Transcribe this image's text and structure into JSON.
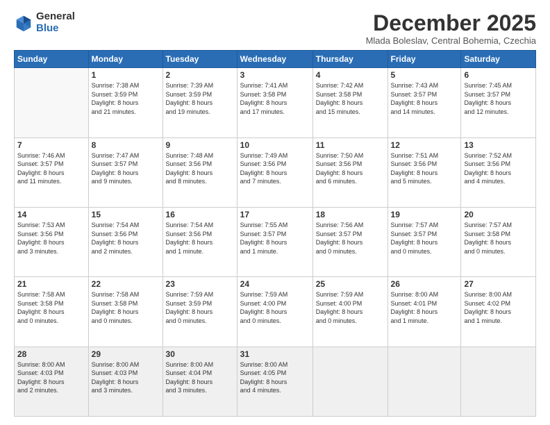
{
  "logo": {
    "general": "General",
    "blue": "Blue"
  },
  "title": "December 2025",
  "subtitle": "Mlada Boleslav, Central Bohemia, Czechia",
  "days_of_week": [
    "Sunday",
    "Monday",
    "Tuesday",
    "Wednesday",
    "Thursday",
    "Friday",
    "Saturday"
  ],
  "weeks": [
    [
      {
        "day": "",
        "info": ""
      },
      {
        "day": "1",
        "info": "Sunrise: 7:38 AM\nSunset: 3:59 PM\nDaylight: 8 hours\nand 21 minutes."
      },
      {
        "day": "2",
        "info": "Sunrise: 7:39 AM\nSunset: 3:59 PM\nDaylight: 8 hours\nand 19 minutes."
      },
      {
        "day": "3",
        "info": "Sunrise: 7:41 AM\nSunset: 3:58 PM\nDaylight: 8 hours\nand 17 minutes."
      },
      {
        "day": "4",
        "info": "Sunrise: 7:42 AM\nSunset: 3:58 PM\nDaylight: 8 hours\nand 15 minutes."
      },
      {
        "day": "5",
        "info": "Sunrise: 7:43 AM\nSunset: 3:57 PM\nDaylight: 8 hours\nand 14 minutes."
      },
      {
        "day": "6",
        "info": "Sunrise: 7:45 AM\nSunset: 3:57 PM\nDaylight: 8 hours\nand 12 minutes."
      }
    ],
    [
      {
        "day": "7",
        "info": "Sunrise: 7:46 AM\nSunset: 3:57 PM\nDaylight: 8 hours\nand 11 minutes."
      },
      {
        "day": "8",
        "info": "Sunrise: 7:47 AM\nSunset: 3:57 PM\nDaylight: 8 hours\nand 9 minutes."
      },
      {
        "day": "9",
        "info": "Sunrise: 7:48 AM\nSunset: 3:56 PM\nDaylight: 8 hours\nand 8 minutes."
      },
      {
        "day": "10",
        "info": "Sunrise: 7:49 AM\nSunset: 3:56 PM\nDaylight: 8 hours\nand 7 minutes."
      },
      {
        "day": "11",
        "info": "Sunrise: 7:50 AM\nSunset: 3:56 PM\nDaylight: 8 hours\nand 6 minutes."
      },
      {
        "day": "12",
        "info": "Sunrise: 7:51 AM\nSunset: 3:56 PM\nDaylight: 8 hours\nand 5 minutes."
      },
      {
        "day": "13",
        "info": "Sunrise: 7:52 AM\nSunset: 3:56 PM\nDaylight: 8 hours\nand 4 minutes."
      }
    ],
    [
      {
        "day": "14",
        "info": "Sunrise: 7:53 AM\nSunset: 3:56 PM\nDaylight: 8 hours\nand 3 minutes."
      },
      {
        "day": "15",
        "info": "Sunrise: 7:54 AM\nSunset: 3:56 PM\nDaylight: 8 hours\nand 2 minutes."
      },
      {
        "day": "16",
        "info": "Sunrise: 7:54 AM\nSunset: 3:56 PM\nDaylight: 8 hours\nand 1 minute."
      },
      {
        "day": "17",
        "info": "Sunrise: 7:55 AM\nSunset: 3:57 PM\nDaylight: 8 hours\nand 1 minute."
      },
      {
        "day": "18",
        "info": "Sunrise: 7:56 AM\nSunset: 3:57 PM\nDaylight: 8 hours\nand 0 minutes."
      },
      {
        "day": "19",
        "info": "Sunrise: 7:57 AM\nSunset: 3:57 PM\nDaylight: 8 hours\nand 0 minutes."
      },
      {
        "day": "20",
        "info": "Sunrise: 7:57 AM\nSunset: 3:58 PM\nDaylight: 8 hours\nand 0 minutes."
      }
    ],
    [
      {
        "day": "21",
        "info": "Sunrise: 7:58 AM\nSunset: 3:58 PM\nDaylight: 8 hours\nand 0 minutes."
      },
      {
        "day": "22",
        "info": "Sunrise: 7:58 AM\nSunset: 3:58 PM\nDaylight: 8 hours\nand 0 minutes."
      },
      {
        "day": "23",
        "info": "Sunrise: 7:59 AM\nSunset: 3:59 PM\nDaylight: 8 hours\nand 0 minutes."
      },
      {
        "day": "24",
        "info": "Sunrise: 7:59 AM\nSunset: 4:00 PM\nDaylight: 8 hours\nand 0 minutes."
      },
      {
        "day": "25",
        "info": "Sunrise: 7:59 AM\nSunset: 4:00 PM\nDaylight: 8 hours\nand 0 minutes."
      },
      {
        "day": "26",
        "info": "Sunrise: 8:00 AM\nSunset: 4:01 PM\nDaylight: 8 hours\nand 1 minute."
      },
      {
        "day": "27",
        "info": "Sunrise: 8:00 AM\nSunset: 4:02 PM\nDaylight: 8 hours\nand 1 minute."
      }
    ],
    [
      {
        "day": "28",
        "info": "Sunrise: 8:00 AM\nSunset: 4:03 PM\nDaylight: 8 hours\nand 2 minutes."
      },
      {
        "day": "29",
        "info": "Sunrise: 8:00 AM\nSunset: 4:03 PM\nDaylight: 8 hours\nand 3 minutes."
      },
      {
        "day": "30",
        "info": "Sunrise: 8:00 AM\nSunset: 4:04 PM\nDaylight: 8 hours\nand 3 minutes."
      },
      {
        "day": "31",
        "info": "Sunrise: 8:00 AM\nSunset: 4:05 PM\nDaylight: 8 hours\nand 4 minutes."
      },
      {
        "day": "",
        "info": ""
      },
      {
        "day": "",
        "info": ""
      },
      {
        "day": "",
        "info": ""
      }
    ]
  ]
}
